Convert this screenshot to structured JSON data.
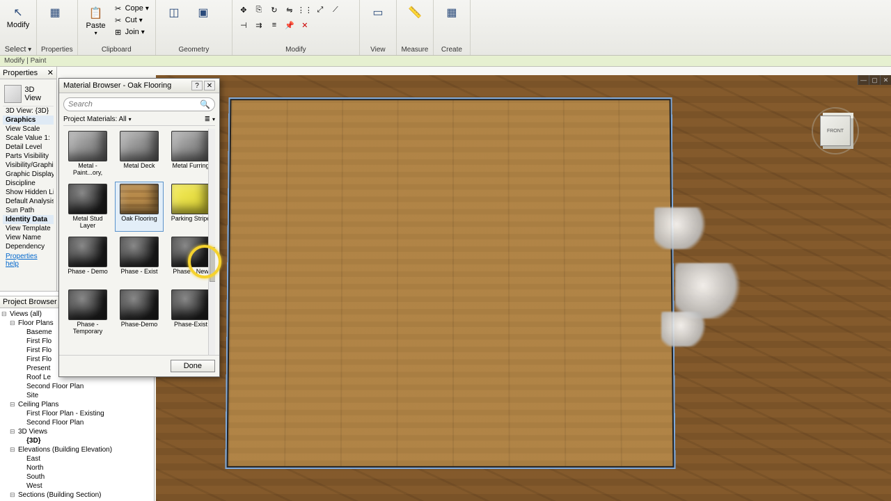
{
  "ribbon": {
    "groups": {
      "select": {
        "modify": "Modify",
        "select": "Select",
        "dropdown": "▾"
      },
      "properties": {
        "label": "Properties"
      },
      "clipboard": {
        "label": "Clipboard",
        "paste": "Paste",
        "cope": "Cope",
        "cut": "Cut",
        "join": "Join"
      },
      "geometry": {
        "label": "Geometry"
      },
      "modify": {
        "label": "Modify"
      },
      "view": {
        "label": "View"
      },
      "measure": {
        "label": "Measure"
      },
      "create": {
        "label": "Create"
      }
    }
  },
  "context_bar": "Modify | Paint",
  "properties": {
    "title": "Properties",
    "view_type": "3D View",
    "view_instance": "3D View: {3D}",
    "categories": {
      "graphics": "Graphics",
      "identity": "Identity Data"
    },
    "rows": {
      "view_scale": "View Scale",
      "scale_value": "Scale Value    1:",
      "detail_level": "Detail Level",
      "parts_vis": "Parts Visibility",
      "vis_graphics": "Visibility/Graphics",
      "graphic_disp": "Graphic Display O",
      "discipline": "Discipline",
      "show_hidden": "Show Hidden Line",
      "default_analysis": "Default Analysis D",
      "sun_path": "Sun Path",
      "view_template": "View Template",
      "view_name": "View Name",
      "dependency": "Dependency"
    },
    "help_link": "Properties help"
  },
  "project_browser": {
    "title": "Project Browser - Re",
    "views_root": "Views (all)",
    "floor_plans": {
      "label": "Floor Plans",
      "items": [
        "Baseme",
        "First Flo",
        "First Flo",
        "First Flo",
        "Present",
        "Roof Le",
        "Second Floor Plan",
        "Site"
      ]
    },
    "ceiling_plans": {
      "label": "Ceiling Plans",
      "items": [
        "First Floor Plan - Existing",
        "Second Floor Plan"
      ]
    },
    "three_d": {
      "label": "3D Views",
      "items": [
        "{3D}"
      ]
    },
    "elevations": {
      "label": "Elevations (Building Elevation)",
      "items": [
        "East",
        "North",
        "South",
        "West"
      ]
    },
    "sections": {
      "label": "Sections (Building Section)"
    }
  },
  "material_browser": {
    "title": "Material Browser - Oak Flooring",
    "search_placeholder": "Search",
    "filter_label": "Project Materials: All",
    "view_mode_icon": "≣",
    "materials": [
      {
        "label": "Metal - Paint...ory,",
        "swatch": "metal"
      },
      {
        "label": "Metal Deck",
        "swatch": "metal"
      },
      {
        "label": "Metal Furring",
        "swatch": "metal"
      },
      {
        "label": "Metal Stud Layer",
        "swatch": "sphere"
      },
      {
        "label": "Oak Flooring",
        "swatch": "oak",
        "selected": true
      },
      {
        "label": "Parking Stripe",
        "swatch": "yellow"
      },
      {
        "label": "Phase - Demo",
        "swatch": "sphere"
      },
      {
        "label": "Phase - Exist",
        "swatch": "sphere"
      },
      {
        "label": "Phase - New",
        "swatch": "sphere"
      },
      {
        "label": "Phase - Temporary",
        "swatch": "sphere"
      },
      {
        "label": "Phase-Demo",
        "swatch": "sphere"
      },
      {
        "label": "Phase-Exist",
        "swatch": "sphere"
      }
    ],
    "done_label": "Done"
  },
  "viewcube": {
    "face": "FRONT"
  }
}
